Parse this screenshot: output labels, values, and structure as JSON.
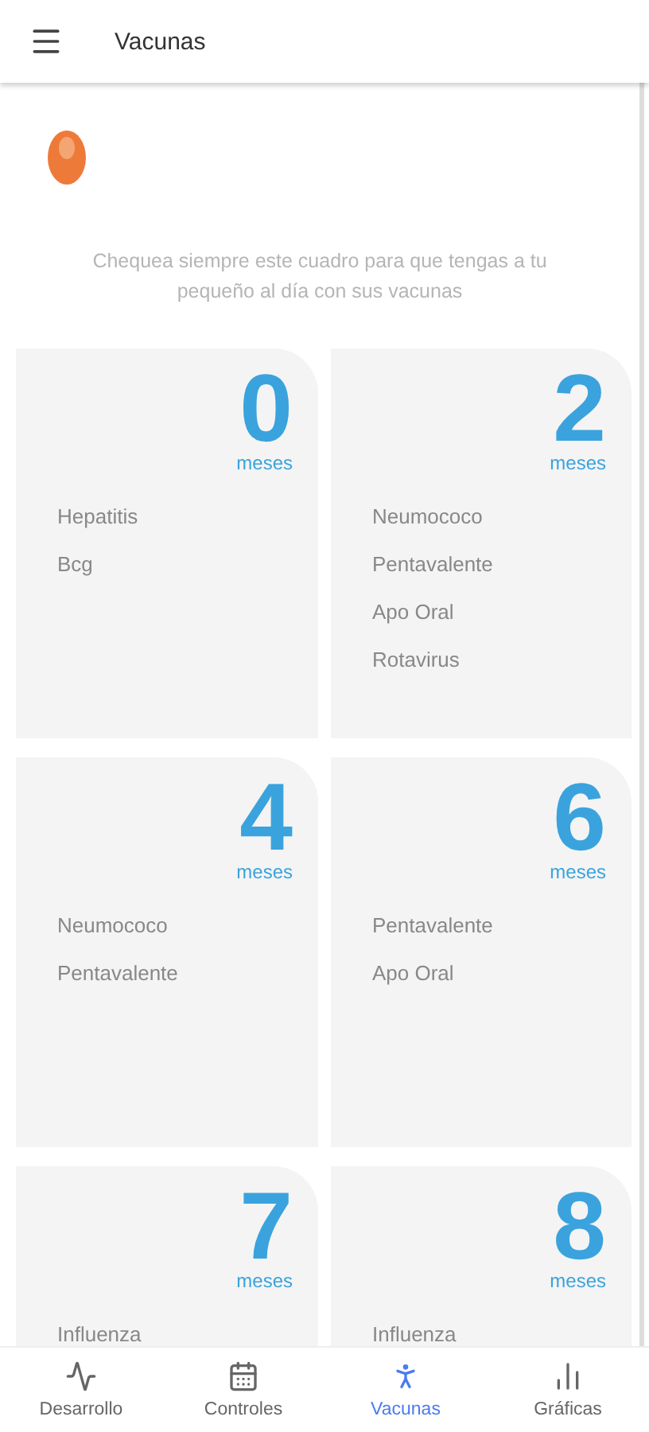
{
  "app_bar": {
    "title": "Vacunas"
  },
  "intro": "Chequea siempre este cuadro para que tengas a tu pequeño al día con sus vacunas",
  "cards": [
    {
      "number": "0",
      "unit": "meses",
      "vaccines": [
        "Hepatitis",
        "Bcg"
      ]
    },
    {
      "number": "2",
      "unit": "meses",
      "vaccines": [
        "Neumococo",
        "Pentavalente",
        "Apo Oral",
        "Rotavirus"
      ]
    },
    {
      "number": "4",
      "unit": "meses",
      "vaccines": [
        "Neumococo",
        "Pentavalente"
      ]
    },
    {
      "number": "6",
      "unit": "meses",
      "vaccines": [
        "Pentavalente",
        "Apo Oral"
      ]
    },
    {
      "number": "7",
      "unit": "meses",
      "vaccines": [
        "Influenza"
      ]
    },
    {
      "number": "8",
      "unit": "meses",
      "vaccines": [
        "Influenza"
      ]
    }
  ],
  "bottom_nav": [
    {
      "kind": "trend",
      "label": "Desarrollo",
      "selected": false
    },
    {
      "kind": "calendar",
      "label": "Controles",
      "selected": false
    },
    {
      "kind": "person",
      "label": "Vacunas",
      "selected": true
    },
    {
      "kind": "bars",
      "label": "Gráficas",
      "selected": false
    }
  ]
}
